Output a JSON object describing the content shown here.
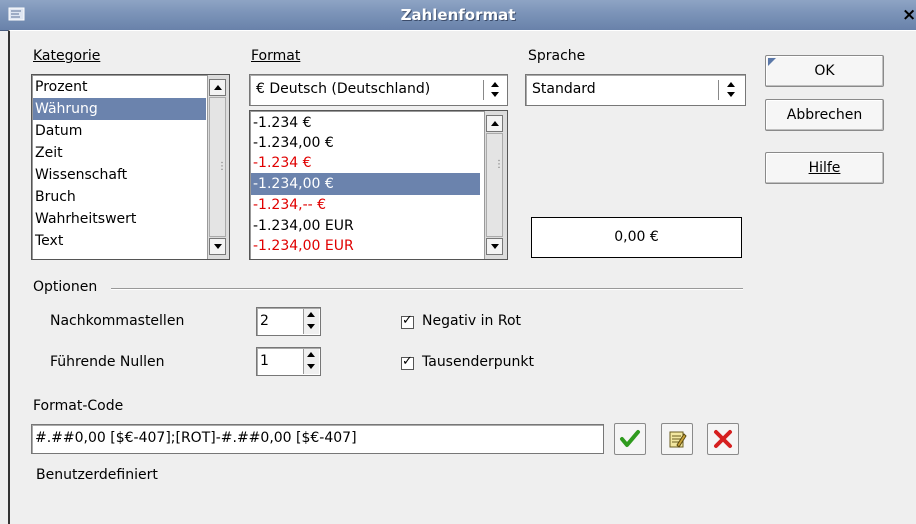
{
  "window": {
    "title": "Zahlenformat",
    "close_glyph": "×"
  },
  "kategorie": {
    "label": "Kategorie",
    "items": [
      {
        "label": "Prozent",
        "selected": false
      },
      {
        "label": "Währung",
        "selected": true
      },
      {
        "label": "Datum",
        "selected": false
      },
      {
        "label": "Zeit",
        "selected": false
      },
      {
        "label": "Wissenschaft",
        "selected": false
      },
      {
        "label": "Bruch",
        "selected": false
      },
      {
        "label": "Wahrheitswert",
        "selected": false
      },
      {
        "label": "Text",
        "selected": false
      }
    ]
  },
  "format": {
    "label": "Format",
    "combo_value": "€ Deutsch (Deutschland)",
    "items": [
      {
        "label": "-1.234 €",
        "color": "#000000",
        "selected": false
      },
      {
        "label": "-1.234,00 €",
        "color": "#000000",
        "selected": false
      },
      {
        "label": "-1.234 €",
        "color": "#e00000",
        "selected": false
      },
      {
        "label": "-1.234,00 €",
        "color": "#ffffff",
        "selected": true
      },
      {
        "label": "-1.234,-- €",
        "color": "#e00000",
        "selected": false
      },
      {
        "label": "-1.234,00 EUR",
        "color": "#000000",
        "selected": false
      },
      {
        "label": "-1.234,00 EUR",
        "color": "#e00000",
        "selected": false
      }
    ]
  },
  "sprache": {
    "label": "Sprache",
    "combo_value": "Standard"
  },
  "buttons": {
    "ok": "OK",
    "abbrechen": "Abbrechen",
    "hilfe": "Hilfe"
  },
  "preview": {
    "value": "0,00 €"
  },
  "optionen": {
    "label": "Optionen",
    "nachkommastellen": {
      "label": "Nachkommastellen",
      "value": "2"
    },
    "fuehrende_nullen": {
      "label": "Führende Nullen",
      "value": "1"
    },
    "negativ_in_rot": {
      "label": "Negativ in Rot",
      "checked": true
    },
    "tausenderpunkt": {
      "label": "Tausenderpunkt",
      "checked": true
    }
  },
  "format_code": {
    "label": "Format-Code",
    "value": "#.##0,00 [$€-407];[ROT]-#.##0,00 [$€-407]",
    "description": "Benutzerdefiniert"
  },
  "colors": {
    "selection": "#6b83ad",
    "negative_red": "#e00000",
    "titlebar": "#7b93b8",
    "accept_green": "#2f9b1e",
    "delete_red": "#d62020"
  }
}
